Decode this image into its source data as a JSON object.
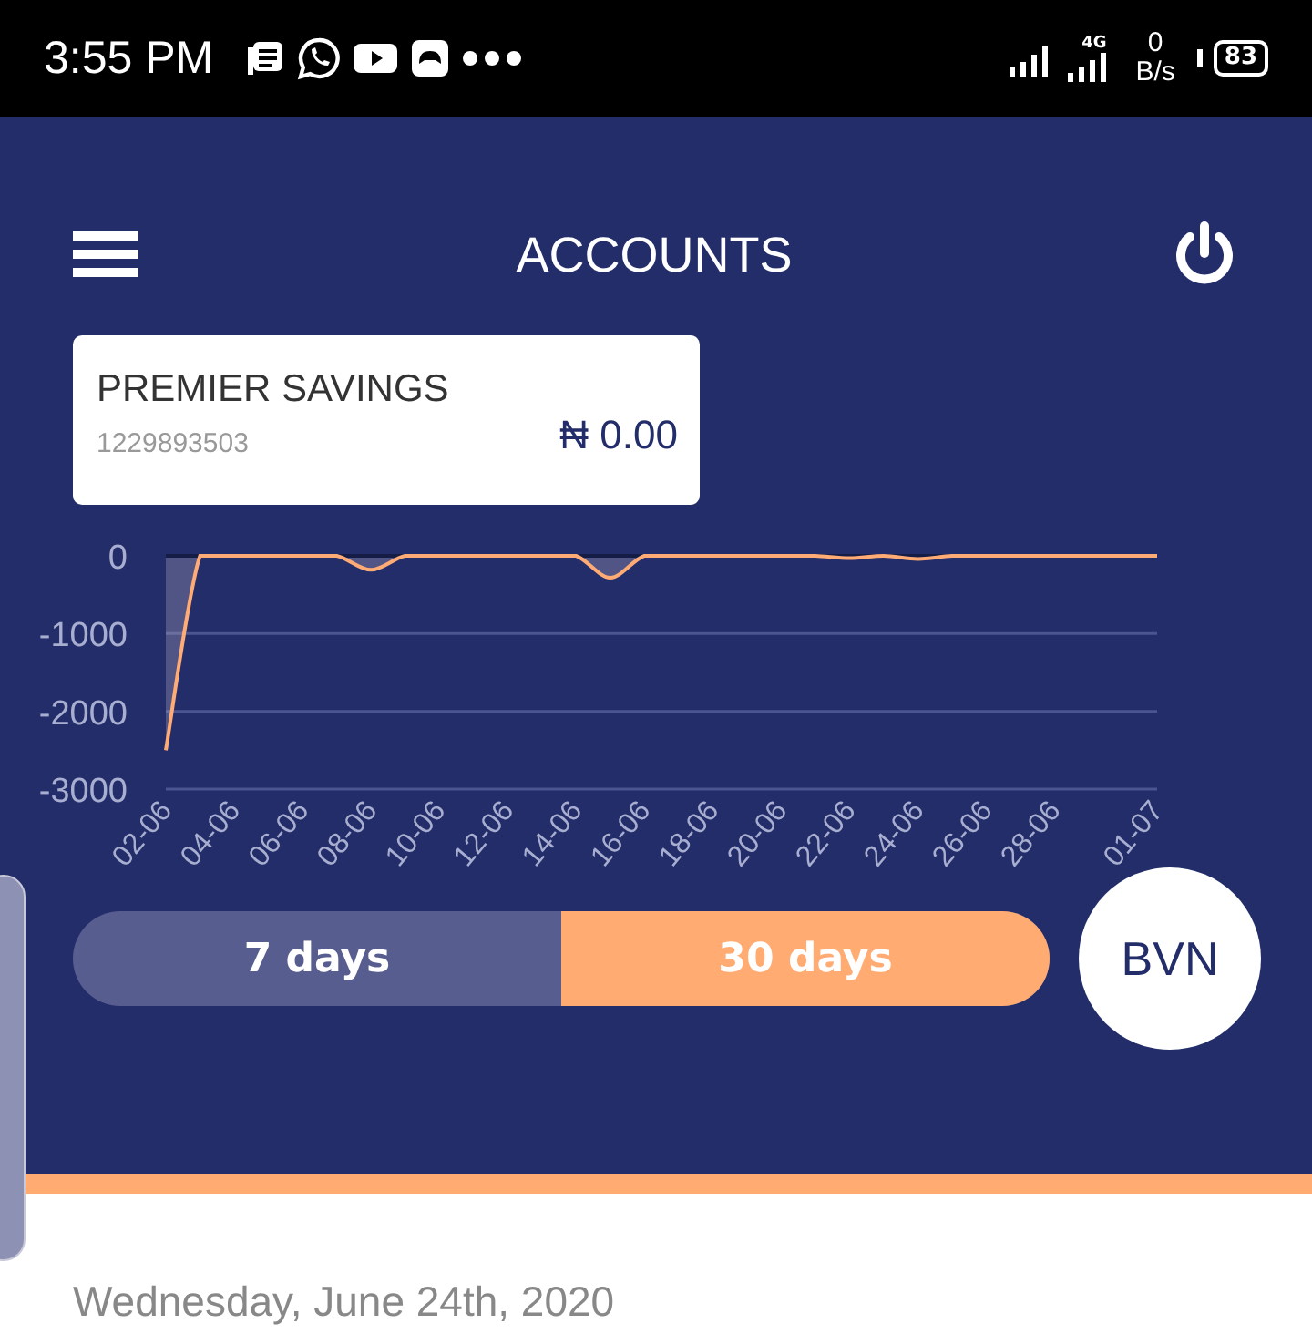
{
  "status_bar": {
    "time": "3:55 PM",
    "network": "4G",
    "speed_value": "0",
    "speed_unit": "B/s",
    "battery": "83"
  },
  "header": {
    "title": "ACCOUNTS"
  },
  "account": {
    "name": "PREMIER SAVINGS",
    "number": "1229893503",
    "balance": "₦ 0.00"
  },
  "chart": {
    "chart_data": {
      "type": "area",
      "categories": [
        "02-06",
        null,
        "04-06",
        null,
        "06-06",
        null,
        "08-06",
        null,
        "10-06",
        null,
        "12-06",
        null,
        "14-06",
        null,
        "16-06",
        null,
        "18-06",
        null,
        "20-06",
        null,
        "22-06",
        null,
        "24-06",
        null,
        "26-06",
        null,
        "28-06",
        null,
        null,
        "01-07"
      ],
      "series": [
        {
          "color": "#ffab76",
          "values": [
            -2500,
            0,
            0,
            0,
            0,
            0,
            -180,
            0,
            0,
            0,
            0,
            0,
            0,
            -280,
            0,
            0,
            0,
            0,
            0,
            0,
            -30,
            0,
            -40,
            0,
            0,
            0,
            0,
            0,
            0,
            0
          ]
        }
      ],
      "ylim": [
        -3000,
        0
      ],
      "yticks": [
        0,
        -1000,
        -2000,
        -3000
      ]
    }
  },
  "periods": [
    {
      "label": "7 days",
      "selected": false
    },
    {
      "label": "30 days",
      "selected": true
    }
  ],
  "bvn_button": "BVN",
  "date": "Wednesday, June 24th, 2020"
}
